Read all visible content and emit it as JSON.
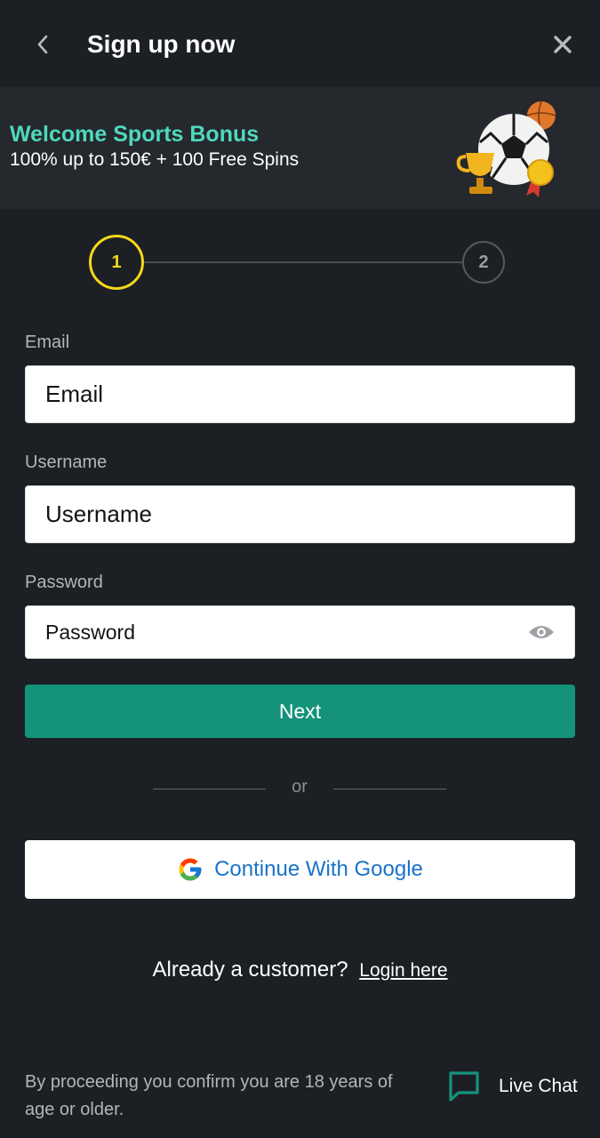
{
  "header": {
    "title": "Sign up now",
    "back_icon": "chevron-left-icon",
    "close_icon": "close-icon"
  },
  "banner": {
    "title": "Welcome Sports Bonus",
    "subtitle": "100% up to 150€ + 100 Free Spins",
    "illustration_icon": "sports-bonus-illustration"
  },
  "stepper": {
    "steps": [
      "1",
      "2"
    ],
    "current_step": 1,
    "active_color": "#f3d81c"
  },
  "form": {
    "email": {
      "label": "Email",
      "placeholder": "Email",
      "value": ""
    },
    "username": {
      "label": "Username",
      "placeholder": "Username",
      "value": ""
    },
    "password": {
      "label": "Password",
      "placeholder": "Password",
      "value": "",
      "toggle_icon": "eye-icon"
    }
  },
  "actions": {
    "next_label": "Next",
    "or_label": "or",
    "google_label": "Continue With Google",
    "google_icon": "google-icon"
  },
  "login": {
    "prompt": "Already a customer?",
    "link_label": "Login here"
  },
  "footer": {
    "disclaimer": "By proceeding you confirm you are 18 years of age or older.",
    "live_chat_label": "Live Chat",
    "live_chat_icon": "chat-bubble-icon"
  },
  "colors": {
    "background": "#1c1f24",
    "banner_bg": "#25282d",
    "accent_teal": "#4fd8bd",
    "primary_button": "#14937a",
    "google_blue": "#1a73c8"
  }
}
